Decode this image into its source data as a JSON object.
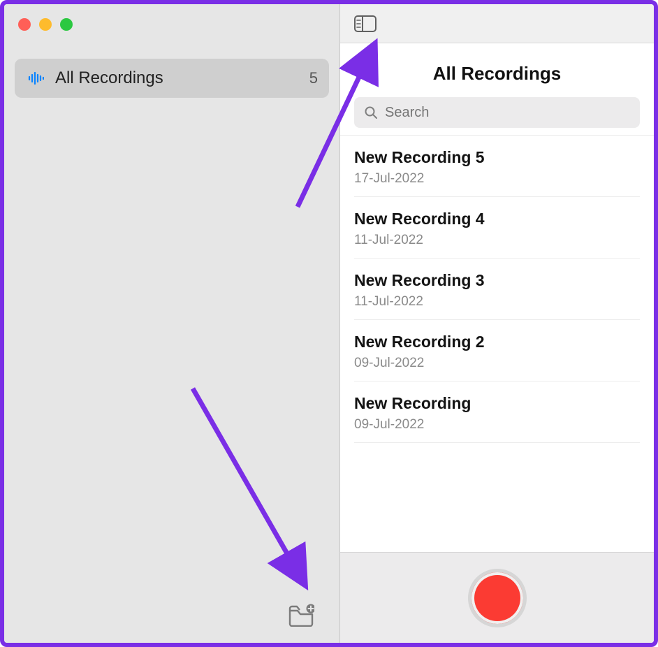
{
  "sidebar": {
    "folder": {
      "label": "All Recordings",
      "count": "5"
    }
  },
  "main": {
    "heading": "All Recordings",
    "search_placeholder": "Search"
  },
  "recordings": [
    {
      "title": "New Recording 5",
      "date": "17-Jul-2022"
    },
    {
      "title": "New Recording 4",
      "date": "11-Jul-2022"
    },
    {
      "title": "New Recording 3",
      "date": "11-Jul-2022"
    },
    {
      "title": "New Recording 2",
      "date": "09-Jul-2022"
    },
    {
      "title": "New Recording",
      "date": "09-Jul-2022"
    }
  ]
}
